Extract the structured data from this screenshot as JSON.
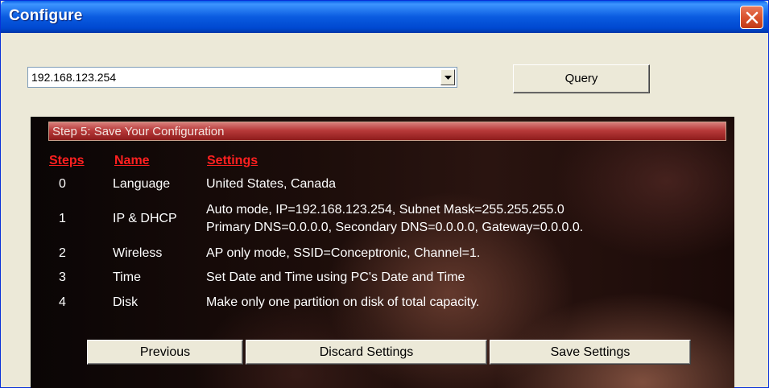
{
  "window": {
    "title": "Configure"
  },
  "toolbar": {
    "address_value": "192.168.123.254",
    "query_label": "Query"
  },
  "step": {
    "title": "Step 5: Save Your Configuration"
  },
  "table": {
    "headers": [
      "Steps",
      "Name",
      "Settings"
    ],
    "rows": [
      {
        "step": "0",
        "name": "Language",
        "settings": [
          "United States, Canada"
        ]
      },
      {
        "step": "1",
        "name": "IP & DHCP",
        "settings": [
          "Auto mode, IP=192.168.123.254, Subnet Mask=255.255.255.0",
          "Primary DNS=0.0.0.0, Secondary DNS=0.0.0.0, Gateway=0.0.0.0."
        ]
      },
      {
        "step": "2",
        "name": "Wireless",
        "settings": [
          "AP only mode, SSID=Conceptronic, Channel=1."
        ]
      },
      {
        "step": "3",
        "name": "Time",
        "settings": [
          "Set Date and Time using PC's Date and Time"
        ]
      },
      {
        "step": "4",
        "name": "Disk",
        "settings": [
          "Make only one partition on disk of total capacity."
        ]
      }
    ]
  },
  "buttons": {
    "previous": "Previous",
    "discard": "Discard Settings",
    "save": "Save Settings"
  },
  "colors": {
    "titlebar": "#0a5be0",
    "header_red": "#ff2020",
    "step_bar": "#b83a3a"
  }
}
